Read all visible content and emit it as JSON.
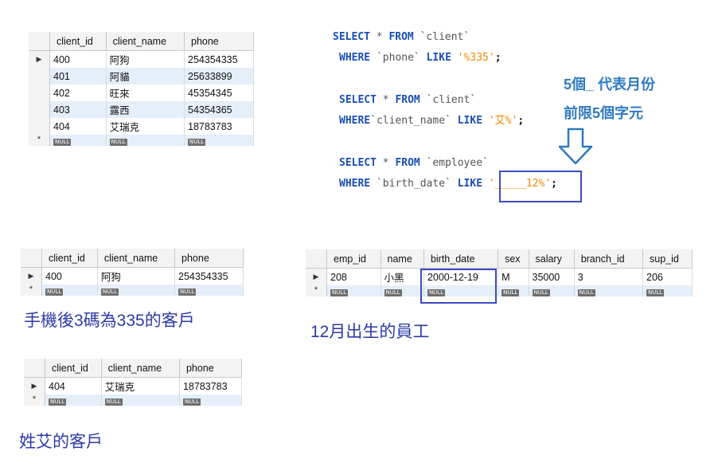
{
  "grid_clients": {
    "headers": [
      "client_id",
      "client_name",
      "phone"
    ],
    "rows": [
      [
        "400",
        "阿狗",
        "254354335"
      ],
      [
        "401",
        "阿貓",
        "25633899"
      ],
      [
        "402",
        "旺來",
        "45354345"
      ],
      [
        "403",
        "露西",
        "54354365"
      ],
      [
        "404",
        "艾瑞克",
        "18783783"
      ]
    ],
    "null_label": "NULL",
    "row_marker": "▶",
    "new_row_marker": "*"
  },
  "grid_phone_result": {
    "headers": [
      "client_id",
      "client_name",
      "phone"
    ],
    "rows": [
      [
        "400",
        "阿狗",
        "254354335"
      ]
    ],
    "caption": "手機後3碼為335的客戶"
  },
  "grid_name_result": {
    "headers": [
      "client_id",
      "client_name",
      "phone"
    ],
    "rows": [
      [
        "404",
        "艾瑞克",
        "18783783"
      ]
    ],
    "caption": "姓艾的客戶"
  },
  "grid_employee_result": {
    "headers": [
      "emp_id",
      "name",
      "birth_date",
      "sex",
      "salary",
      "branch_id",
      "sup_id"
    ],
    "rows": [
      [
        "208",
        "小黑",
        "2000-12-19",
        "M",
        "35000",
        "3",
        "206"
      ]
    ],
    "caption": "12月出生的員工"
  },
  "sql": {
    "q1_line1": [
      "SELECT",
      " * ",
      "FROM",
      " `client`"
    ],
    "q1_line2": [
      "WHERE",
      " `phone` ",
      "LIKE",
      " '%335'",
      ";"
    ],
    "q2_line1": [
      "SELECT",
      " * ",
      "FROM",
      " `client`"
    ],
    "q2_line2": [
      "WHERE",
      "`client_name` ",
      "LIKE",
      " '艾%'",
      ";"
    ],
    "q3_line1": [
      "SELECT",
      " * ",
      "FROM",
      " `employee`"
    ],
    "q3_line2": [
      "WHERE",
      " `birth_date` ",
      "LIKE",
      " '_____12%'",
      ";"
    ]
  },
  "annotation": {
    "line1": "5個_ 代表月份",
    "line2": "前限5個字元",
    "arrow_icon": "down-arrow-icon"
  },
  "colors": {
    "keyword": "#1a4fb5",
    "string": "#f08a00",
    "caption": "#2b3aa8",
    "annotation": "#2f7ac0",
    "highlight_box": "#3b4cc0",
    "alt_row": "#e4effa"
  }
}
